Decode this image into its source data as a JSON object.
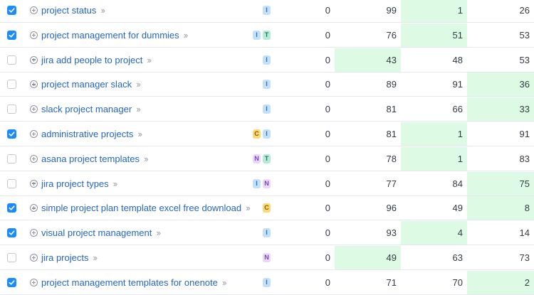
{
  "rows": [
    {
      "checked": true,
      "keyword": "project status",
      "intents": [
        "I"
      ],
      "values": [
        "0",
        "99",
        "1",
        "26"
      ],
      "highlight": [
        false,
        false,
        true,
        false
      ]
    },
    {
      "checked": true,
      "keyword": "project management for dummies",
      "intents": [
        "I",
        "T"
      ],
      "values": [
        "0",
        "76",
        "51",
        "53"
      ],
      "highlight": [
        false,
        false,
        true,
        false
      ]
    },
    {
      "checked": false,
      "keyword": "jira add people to project",
      "intents": [
        "I"
      ],
      "values": [
        "0",
        "43",
        "48",
        "53"
      ],
      "highlight": [
        false,
        true,
        false,
        false
      ]
    },
    {
      "checked": false,
      "keyword": "project manager slack",
      "intents": [
        "I"
      ],
      "values": [
        "0",
        "89",
        "91",
        "36"
      ],
      "highlight": [
        false,
        false,
        false,
        true
      ]
    },
    {
      "checked": false,
      "keyword": "slack project manager",
      "intents": [
        "I"
      ],
      "values": [
        "0",
        "81",
        "66",
        "33"
      ],
      "highlight": [
        false,
        false,
        false,
        true
      ]
    },
    {
      "checked": true,
      "keyword": "administrative projects",
      "intents": [
        "C",
        "I"
      ],
      "values": [
        "0",
        "81",
        "1",
        "91"
      ],
      "highlight": [
        false,
        false,
        true,
        false
      ]
    },
    {
      "checked": false,
      "keyword": "asana project templates",
      "intents": [
        "N",
        "T"
      ],
      "values": [
        "0",
        "78",
        "1",
        "83"
      ],
      "highlight": [
        false,
        false,
        true,
        false
      ]
    },
    {
      "checked": false,
      "keyword": "jira project types",
      "intents": [
        "I",
        "N"
      ],
      "values": [
        "0",
        "77",
        "84",
        "75"
      ],
      "highlight": [
        false,
        false,
        false,
        true
      ]
    },
    {
      "checked": true,
      "keyword": "simple project plan template excel free download",
      "intents": [
        "C"
      ],
      "values": [
        "0",
        "96",
        "49",
        "8"
      ],
      "highlight": [
        false,
        false,
        false,
        true
      ]
    },
    {
      "checked": true,
      "keyword": "visual project management",
      "intents": [
        "I"
      ],
      "values": [
        "0",
        "93",
        "4",
        "14"
      ],
      "highlight": [
        false,
        false,
        true,
        false
      ]
    },
    {
      "checked": false,
      "keyword": "jira projects",
      "intents": [
        "N"
      ],
      "values": [
        "0",
        "49",
        "63",
        "73"
      ],
      "highlight": [
        false,
        true,
        false,
        false
      ]
    },
    {
      "checked": true,
      "keyword": "project management templates for onenote",
      "intents": [
        "I"
      ],
      "values": [
        "0",
        "71",
        "70",
        "2"
      ],
      "highlight": [
        false,
        false,
        false,
        true
      ]
    }
  ]
}
